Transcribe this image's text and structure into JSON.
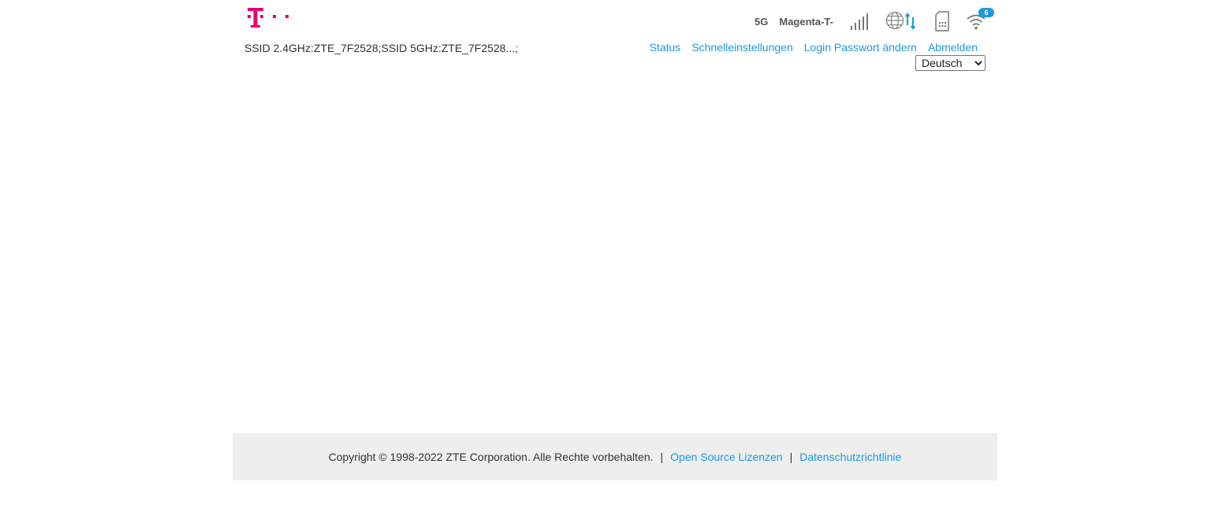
{
  "header": {
    "logo": "T · ·",
    "network_type": "5G",
    "operator": "Magenta-T-",
    "wifi_clients": "6",
    "icons": [
      "telekom-logo",
      "signal-strength-icon",
      "globe-transfer-icon",
      "sim-card-icon",
      "wifi-icon"
    ],
    "accent_color": "#1a9ae0",
    "brand_color": "#e20074"
  },
  "ssid_text": "SSID 2.4GHz:ZTE_7F2528;SSID 5GHz:ZTE_7F2528...;",
  "nav": {
    "status": "Status",
    "quick_settings": "Schnelleinstellungen",
    "change_password": "Login Passwort ändern",
    "logout": "Abmelden"
  },
  "language": {
    "selected": "Deutsch"
  },
  "footer": {
    "copyright": "Copyright © 1998-2022 ZTE Corporation. Alle Rechte vorbehalten.",
    "separator": "|",
    "open_source": "Open Source Lizenzen",
    "privacy": "Datenschutzrichtlinie"
  }
}
